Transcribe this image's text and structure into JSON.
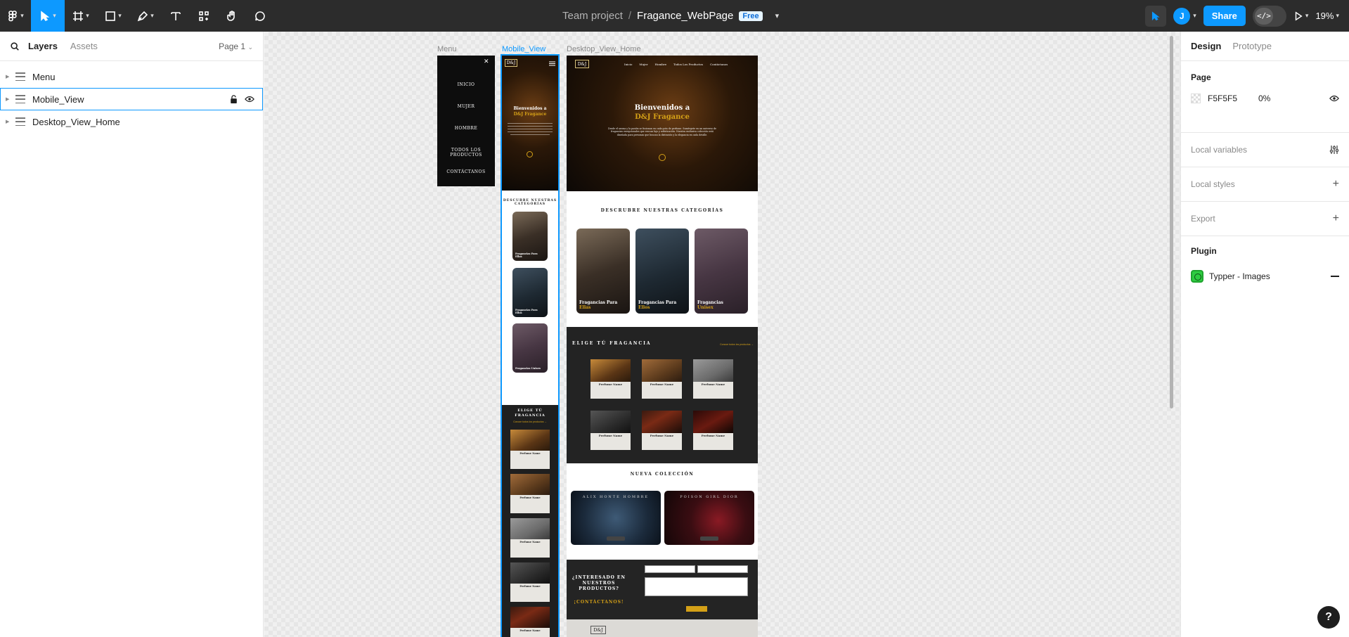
{
  "toolbar": {
    "project": "Team project",
    "separator": "/",
    "file_name": "Fragance_WebPage",
    "plan_badge": "Free",
    "avatar_initial": "J",
    "share_label": "Share",
    "dev_mode_glyph": "</>",
    "zoom": "19%",
    "accent_color": "#0d99ff"
  },
  "left_panel": {
    "tabs": [
      "Layers",
      "Assets"
    ],
    "page_selector": "Page 1",
    "layers": [
      {
        "name": "Menu"
      },
      {
        "name": "Mobile_View"
      },
      {
        "name": "Desktop_View_Home"
      }
    ]
  },
  "canvas": {
    "frame_labels": [
      "Menu",
      "Mobile_View",
      "Desktop_View_Home"
    ],
    "menu_frame": {
      "items": [
        "INICIO",
        "MUJER",
        "HOMBRE",
        "TODOS LOS PRODUCTOS",
        "CONTÁCTANOS"
      ],
      "close_glyph": "✕"
    },
    "mobile": {
      "logo": "D&J",
      "hero_title_1": "Bienvenidos a",
      "hero_title_2": "D&J Fragance",
      "categories_title": "DESCUBRE NUESTRAS CATEGORÍAS",
      "cat1": "Fragancias Para Ellas",
      "cat2": "Fragancias Para Ellos",
      "cat3": "Fragancias Unisex",
      "choose_title": "ELIGE TÚ FRAGANCIA",
      "choose_link": "Conoce todos los productos →",
      "product_name": "Perfume Name"
    },
    "desktop": {
      "logo": "D&J",
      "nav": [
        "Inicio",
        "Mujer",
        "Hombre",
        "Todos Los Productos",
        "Contáctanos"
      ],
      "hero_title_1": "Bienvenidos a",
      "hero_title_2": "D&J Fragance",
      "hero_text": "Desde el aroma y la pasión se fusionan en cada gota de perfume. Sumérgete en un universo de fragancias excepcionales que evocan lujo y sofisticación. Nuestra exclusiva colección está diseñada para personas que buscan la distinción y la elegancia en cada detalle.",
      "categories_title": "DESCRUBRE NUESTRAS CATEGORÍAS",
      "cat1_a": "Fragancias Para",
      "cat1_b": "Ellas",
      "cat2_a": "Fragancias Para",
      "cat2_b": "Ellos",
      "cat3_a": "Fragancias",
      "cat3_b": "Unisex",
      "choose_title": "ELIGE TÚ FRAGANCIA",
      "choose_link": "Conoce todos los productos →",
      "product_name": "Perfume Name",
      "new_collection_title": "NUEVA COLECCIÓN",
      "coll1_title": "ALIX HONTE HOMBRE",
      "coll2_title": "POISON GIRL DIOR",
      "contact_title": "¿INTERESADO EN NUESTROS PRODUCTOS?",
      "contact_cta": "¡CONTÁCTANOS!",
      "footer_logo": "D&J"
    }
  },
  "right_panel": {
    "tabs": [
      "Design",
      "Prototype"
    ],
    "page_heading": "Page",
    "page_color": "F5F5F5",
    "page_opacity": "0%",
    "local_variables": "Local variables",
    "local_styles": "Local styles",
    "export": "Export",
    "plugin_heading": "Plugin",
    "plugin_name": "Typper - Images",
    "plugin_color": "#2ecc40"
  },
  "help": "?"
}
